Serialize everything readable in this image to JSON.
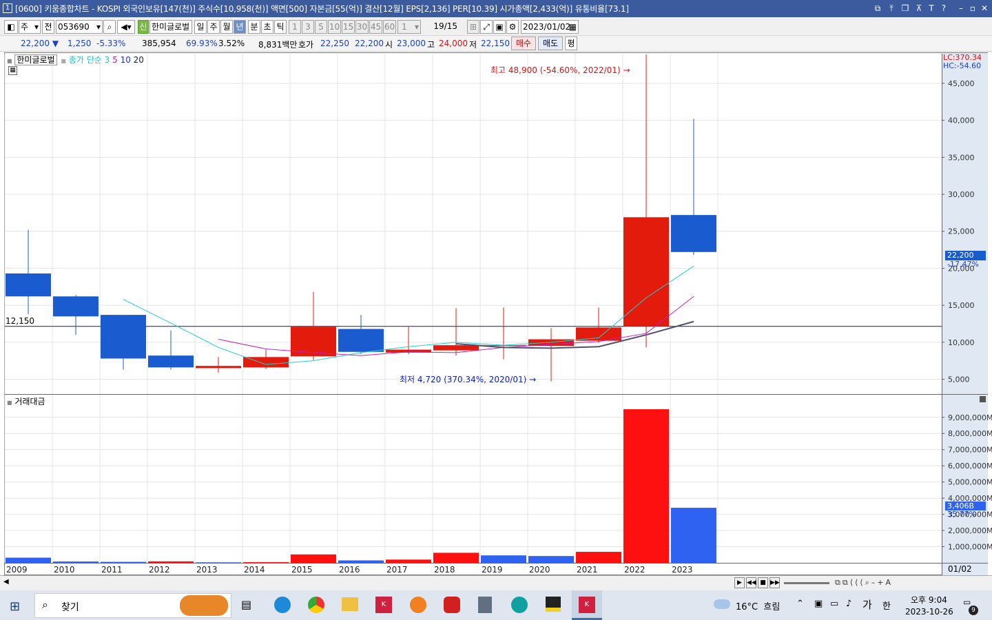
{
  "window": {
    "index": "1",
    "title": "[0600] 키움종합차트 - KOSPI 외국인보유[147(천)] 주식수[10,958(천)] 액면[500] 자본금[55(억)] 결산[12월] EPS[2,136] PER[10.39] 시가총액[2,433(억)] 유통비율[73.1]"
  },
  "toolbar": {
    "period_type": "주",
    "all_label": "전",
    "code": "053690",
    "new_badge": "신",
    "stock_name": "한미글로벌",
    "tf_day": "일",
    "tf_week": "주",
    "tf_month": "월",
    "tf_year": "년",
    "tf_min": "분",
    "tf_sec": "초",
    "tf_tick": "틱",
    "intervals": [
      "1",
      "3",
      "5",
      "10",
      "15",
      "30",
      "45",
      "60"
    ],
    "interval_sel": "1",
    "page": "19",
    "page_total": "/15",
    "date": "2023/01/02"
  },
  "quote": {
    "price": "22,200",
    "arrow": "▼",
    "change": "1,250",
    "change_pct": "-5.33%",
    "volume": "385,954",
    "vol_ratio": "69.93%",
    "turnover": "3.52%",
    "amount": "8,831백만",
    "ask_label": "호가",
    "ask": "22,250",
    "bid": "22,200",
    "open_label": "시",
    "open": "23,000",
    "high_label": "고",
    "high": "24,000",
    "low_label": "저",
    "low": "22,150",
    "buy_label": "매수",
    "sell_label": "매도",
    "eval_label": "평"
  },
  "price_panel": {
    "title": "한미글로벌",
    "ma_label": "종가 단순",
    "ma_periods": [
      "3",
      "5",
      "10",
      "20"
    ],
    "ma_colors": [
      "#20d0d0",
      "#c020c0",
      "#2030c0",
      "#404060"
    ],
    "ref_line_label": "12,150",
    "high_note": "최고 48,900 (-54.60%, 2022/01)",
    "low_note": "최저 4,720 (370.34%, 2020/01)",
    "lc_label": "LC:370.34",
    "hc_label": "HC:-54.60",
    "last_price": "22,200",
    "last_pct": "-17.47%"
  },
  "volume_panel": {
    "title": "거래대금",
    "last_value": "3,406B",
    "last_pct": "35.77%"
  },
  "chart_data": {
    "type": "candlestick",
    "categories": [
      "2009",
      "2010",
      "2011",
      "2012",
      "2013",
      "2014",
      "2015",
      "2016",
      "2017",
      "2018",
      "2019",
      "2020",
      "2021",
      "2022",
      "2023"
    ],
    "candles": [
      {
        "x": "2009",
        "open": 16200,
        "high": 25200,
        "low": 13800,
        "close": 19300,
        "dir": "down"
      },
      {
        "x": "2010",
        "open": 16200,
        "high": 16400,
        "low": 11000,
        "close": 13500,
        "dir": "down"
      },
      {
        "x": "2011",
        "open": 13700,
        "high": 13700,
        "low": 6300,
        "close": 7800,
        "dir": "down"
      },
      {
        "x": "2012",
        "open": 8200,
        "high": 11600,
        "low": 6300,
        "close": 6600,
        "dir": "down"
      },
      {
        "x": "2013",
        "open": 6800,
        "high": 8000,
        "low": 5900,
        "close": 6500,
        "dir": "up"
      },
      {
        "x": "2014",
        "open": 6600,
        "high": 9000,
        "low": 6400,
        "close": 8000,
        "dir": "up"
      },
      {
        "x": "2015",
        "open": 8100,
        "high": 16800,
        "low": 7600,
        "close": 12100,
        "dir": "up"
      },
      {
        "x": "2016",
        "open": 8700,
        "high": 13700,
        "low": 8400,
        "close": 11800,
        "dir": "down"
      },
      {
        "x": "2017",
        "open": 8600,
        "high": 12100,
        "low": 8400,
        "close": 9000,
        "dir": "up"
      },
      {
        "x": "2018",
        "open": 8900,
        "high": 14600,
        "low": 8200,
        "close": 9600,
        "dir": "up"
      },
      {
        "x": "2019",
        "open": 9500,
        "high": 14700,
        "low": 7700,
        "close": 9600,
        "dir": "up"
      },
      {
        "x": "2020",
        "open": 9500,
        "high": 11900,
        "low": 4720,
        "close": 10400,
        "dir": "up"
      },
      {
        "x": "2021",
        "open": 10200,
        "high": 14700,
        "low": 9900,
        "close": 12000,
        "dir": "up"
      },
      {
        "x": "2022",
        "open": 12200,
        "high": 48900,
        "low": 9300,
        "close": 26900,
        "dir": "up"
      },
      {
        "x": "2023",
        "open": 27200,
        "high": 40200,
        "low": 21800,
        "close": 22200,
        "dir": "down"
      }
    ],
    "ma": [
      {
        "period": "3",
        "values": [
          null,
          null,
          15800,
          12600,
          9300,
          7000,
          7500,
          8600,
          9400,
          10000,
          9600,
          10000,
          10600,
          16000,
          20300
        ]
      },
      {
        "period": "5",
        "values": [
          null,
          null,
          null,
          null,
          10400,
          9100,
          8600,
          8200,
          8700,
          8600,
          9300,
          9700,
          10100,
          11200,
          16200
        ]
      },
      {
        "period": "10",
        "values": [
          null,
          null,
          null,
          null,
          null,
          null,
          null,
          null,
          null,
          9800,
          9300,
          9200,
          9400,
          11000,
          12800
        ]
      }
    ],
    "ref_line": 12150,
    "y_ticks": [
      "5,000",
      "10,000",
      "15,000",
      "20,000",
      "25,000",
      "30,000",
      "35,000",
      "40,000",
      "45,000"
    ],
    "ylim": [
      3000,
      49000
    ],
    "volume": {
      "values": [
        320,
        80,
        60,
        90,
        30,
        40,
        520,
        150,
        200,
        620,
        460,
        420,
        680,
        9500,
        3406
      ],
      "unit": "백만",
      "dirs": [
        "down",
        "down",
        "down",
        "up",
        "down",
        "up",
        "up",
        "down",
        "up",
        "up",
        "down",
        "down",
        "up",
        "up",
        "down"
      ],
      "y_ticks": [
        "1,000,000M",
        "2,000,000M",
        "3,000,000M",
        "4,000,000M",
        "5,000,000M",
        "6,000,000M",
        "7,000,000M",
        "8,000,000M",
        "9,000,000M"
      ],
      "ylim": [
        0,
        9800
      ]
    },
    "x_extra_label": "01/02"
  },
  "taskbar": {
    "search_label": "찾기",
    "weather": "16°C  흐림",
    "ime_lang": "가",
    "ime_mode": "한",
    "time": "오후 9:04",
    "date": "2023-10-26",
    "notif_count": "9"
  },
  "colors": {
    "up": "#e31b0c",
    "down": "#1a5ccf",
    "vol_down": "#2f62f0",
    "titlebar": "#3c5a9e",
    "axis_bg": "#dfe8f3"
  }
}
